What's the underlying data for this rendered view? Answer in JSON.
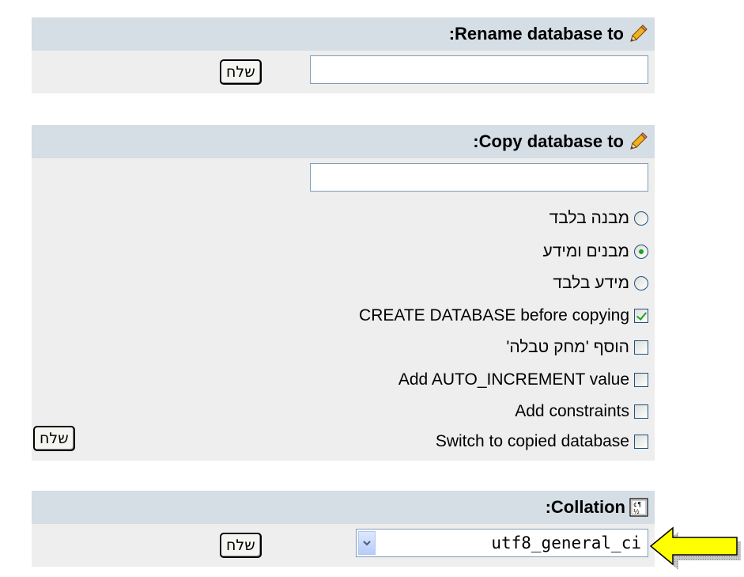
{
  "rename": {
    "title": ":Rename database to",
    "input_value": "",
    "go_label": "שלח"
  },
  "copy": {
    "title": ":Copy database to",
    "input_value": "",
    "options": {
      "structure_only": "מבנה בלבד",
      "structure_and_data": "מבנים ומידע",
      "data_only": "מידע בלבד",
      "create_db": "CREATE DATABASE before copying",
      "add_drop_table": "הוסף 'מחק טבלה'",
      "auto_increment": "Add AUTO_INCREMENT value",
      "constraints": "Add constraints",
      "switch_db": "Switch to copied database"
    },
    "selected_mode": "structure_and_data",
    "checked": {
      "create_db": true,
      "add_drop_table": false,
      "auto_increment": false,
      "constraints": false,
      "switch_db": false
    },
    "go_label": "שלח"
  },
  "collation": {
    "title": ":Collation",
    "selected": "utf8_general_ci",
    "go_label": "שלח"
  },
  "icons": {
    "rename": "pencil-icon",
    "copy": "pencil-icon",
    "collation": "charset-icon",
    "callout": "arrow-left-icon"
  },
  "colors": {
    "header_bg": "#d5dde5",
    "panel_bg": "#eeeeee",
    "check_green": "#21a121",
    "arrow_yellow": "#ffff00"
  }
}
